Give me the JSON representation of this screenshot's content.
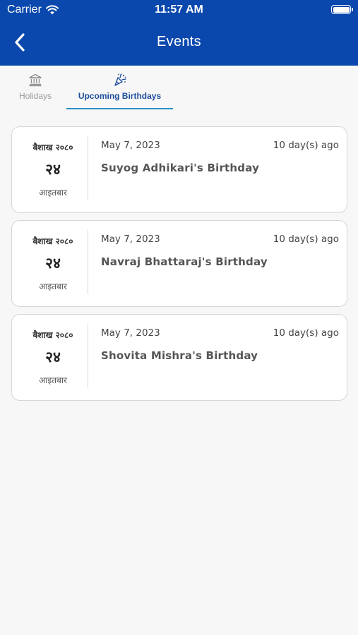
{
  "status_bar": {
    "carrier": "Carrier",
    "time": "11:57 AM",
    "battery_level": 1.0
  },
  "nav": {
    "title": "Events",
    "back_icon": "chevron-left-icon"
  },
  "tabs": [
    {
      "label": "Holidays",
      "icon": "bank-icon",
      "active": false
    },
    {
      "label": "Upcoming Birthdays",
      "icon": "party-popper-icon",
      "active": true
    }
  ],
  "events": [
    {
      "nep_month": "बैशाख २०८०",
      "nep_day": "२४",
      "nep_weekday": "आइतबार",
      "date": "May 7, 2023",
      "ago": "10 day(s) ago",
      "title": "Suyog Adhikari's Birthday"
    },
    {
      "nep_month": "बैशाख २०८०",
      "nep_day": "२४",
      "nep_weekday": "आइतबार",
      "date": "May 7, 2023",
      "ago": "10 day(s) ago",
      "title": "Navraj Bhattaraj's Birthday"
    },
    {
      "nep_month": "बैशाख २०८०",
      "nep_day": "२४",
      "nep_weekday": "आइतबार",
      "date": "May 7, 2023",
      "ago": "10 day(s) ago",
      "title": "Shovita Mishra's Birthday"
    }
  ],
  "colors": {
    "header_bg": "#0a48ad",
    "active_tab_text": "#1d4d9c",
    "active_tab_underline": "#2a8fc7",
    "inactive_tab_text": "#9a9a9a"
  }
}
